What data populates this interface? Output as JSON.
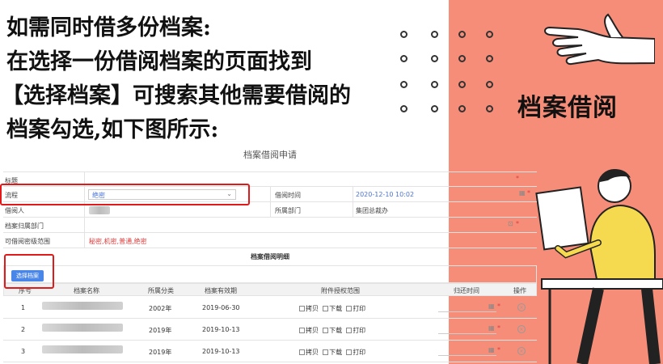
{
  "instruction_lines": [
    "如需同时借多份档案:",
    "在选择一份借阅档案的页面找到",
    "【选择档案】可搜索其他需要借阅的",
    "档案勾选,如下图所示:"
  ],
  "panel_title": "档案借阅",
  "form": {
    "title": "档案借阅申请",
    "fields": {
      "title_label": "标题",
      "process_label": "流程",
      "process_value": "绝密",
      "borrow_time_label": "借阅时间",
      "borrow_time_value": "2020-12-10 10:02",
      "borrower_label": "借阅人",
      "dept_label": "所属部门",
      "dept_value": "集团总裁办",
      "archive_dept_label": "档案归属部门",
      "range_label": "可借阅密级范围",
      "range_value": "秘密,机密,普通,绝密"
    },
    "detail_title": "档案借阅明细",
    "select_button": "选择档案",
    "columns": [
      "序号",
      "档案名称",
      "所属分类",
      "档案有效期",
      "附件授权范围",
      "归还时间",
      "操作"
    ],
    "perms": [
      "拷贝",
      "下载",
      "打印"
    ],
    "rows": [
      {
        "no": "1",
        "category": "2002年",
        "expiry": "2019-06-30"
      },
      {
        "no": "2",
        "category": "2019年",
        "expiry": "2019-10-13"
      },
      {
        "no": "3",
        "category": "2019年",
        "expiry": "2019-10-13"
      }
    ]
  },
  "icons": [
    "calendar-icon",
    "delete-circle-icon",
    "dropdown-chevron-icon",
    "hand-illustration",
    "person-illustration"
  ],
  "colors": {
    "panel": "#f58d78",
    "accent_red": "#e01a1a",
    "button_blue": "#4a86e8",
    "link_blue": "#4a74d9"
  }
}
